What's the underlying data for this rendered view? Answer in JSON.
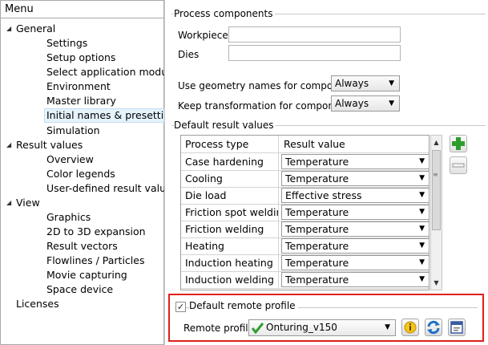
{
  "menu": {
    "header": "Menu",
    "items": [
      {
        "label": "General",
        "level": 0,
        "expanded": true
      },
      {
        "label": "Settings",
        "level": 1
      },
      {
        "label": "Setup options",
        "level": 1
      },
      {
        "label": "Select application module",
        "level": 1
      },
      {
        "label": "Environment",
        "level": 1
      },
      {
        "label": "Master library",
        "level": 1
      },
      {
        "label": "Initial names & presettings",
        "level": 1,
        "selected": true
      },
      {
        "label": "Simulation",
        "level": 1
      },
      {
        "label": "Result values",
        "level": 0,
        "expanded": true
      },
      {
        "label": "Overview",
        "level": 1
      },
      {
        "label": "Color legends",
        "level": 1
      },
      {
        "label": "User-defined result values",
        "level": 1
      },
      {
        "label": "View",
        "level": 0,
        "expanded": true
      },
      {
        "label": "Graphics",
        "level": 1
      },
      {
        "label": "2D to 3D expansion",
        "level": 1
      },
      {
        "label": "Result vectors",
        "level": 1
      },
      {
        "label": "Flowlines / Particles",
        "level": 1
      },
      {
        "label": "Movie capturing",
        "level": 1
      },
      {
        "label": "Space device",
        "level": 1
      },
      {
        "label": "Licenses",
        "level": 0
      }
    ]
  },
  "process_components": {
    "title": "Process components",
    "workpiece_label": "Workpiece:",
    "workpiece_value": "",
    "dies_label": "Dies",
    "dies_value": "",
    "geom_names_label": "Use geometry names for components:",
    "geom_names_value": "Always",
    "keep_transform_label": "Keep transformation for components:",
    "keep_transform_value": "Always"
  },
  "default_results": {
    "title": "Default result values",
    "col_process": "Process type",
    "col_value": "Result value",
    "rows": [
      {
        "process": "Case hardening",
        "value": "Temperature"
      },
      {
        "process": "Cooling",
        "value": "Temperature"
      },
      {
        "process": "Die load",
        "value": "Effective stress"
      },
      {
        "process": "Friction spot welding",
        "value": "Temperature"
      },
      {
        "process": "Friction welding",
        "value": "Temperature"
      },
      {
        "process": "Heating",
        "value": "Temperature"
      },
      {
        "process": "Induction heating",
        "value": "Temperature"
      },
      {
        "process": "Induction welding",
        "value": "Temperature"
      }
    ],
    "add_icon": "plus-icon",
    "remove_icon": "minus-icon"
  },
  "remote_profile": {
    "checkbox_label": "Default remote profile",
    "checked": true,
    "profile_label": "Remote profile:",
    "profile_value": "Onturing_v150",
    "info_icon": "info-icon",
    "refresh_icon": "refresh-icon",
    "edit_icon": "edit-icon"
  },
  "colors": {
    "accent_green": "#2e9d2e",
    "highlight_red": "#e0201a",
    "selection_blue": "#e5f3fb"
  }
}
